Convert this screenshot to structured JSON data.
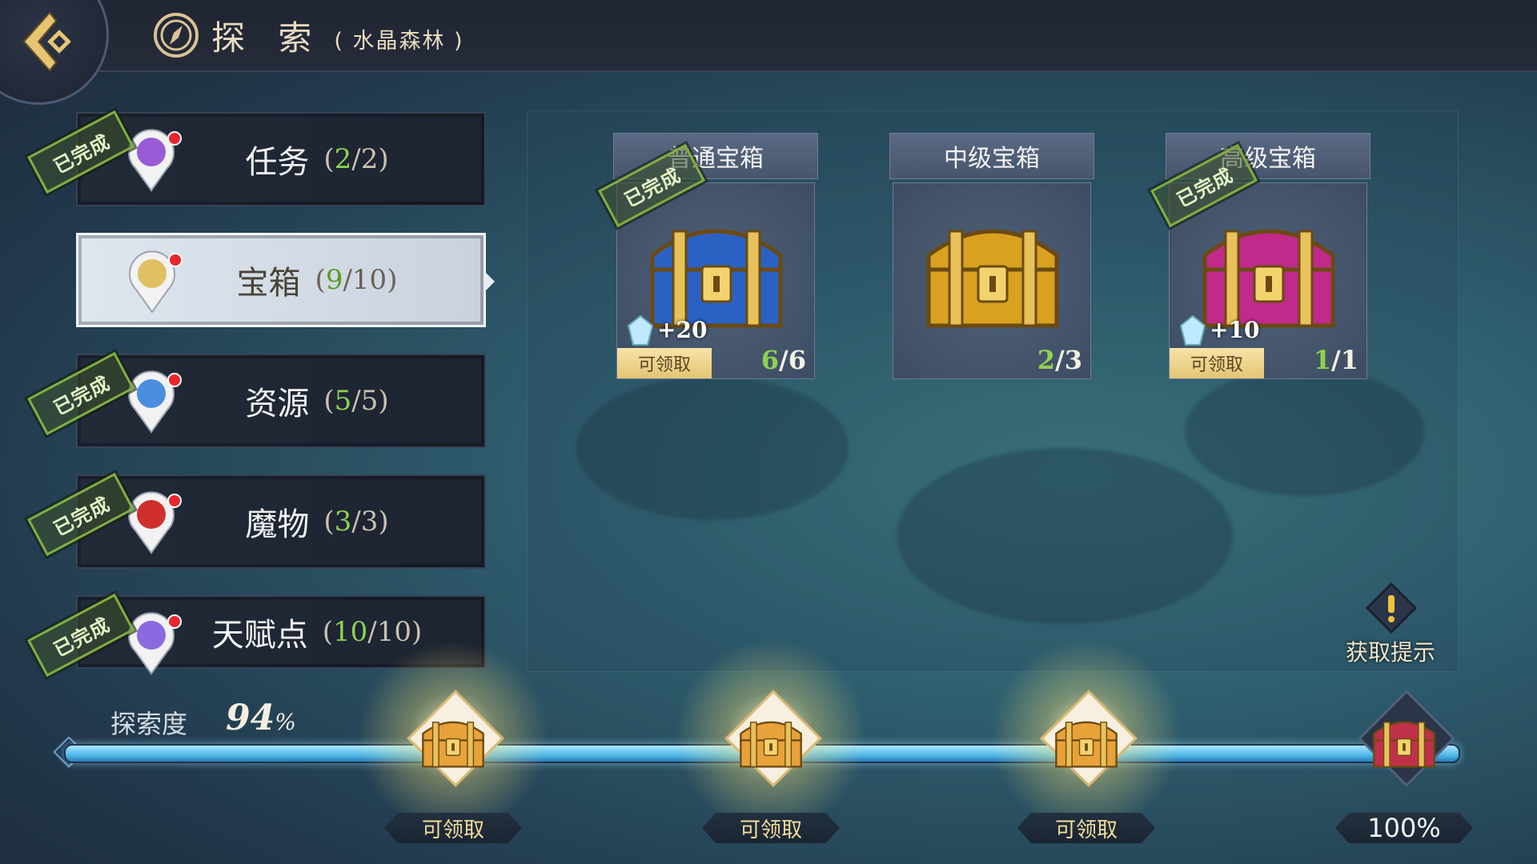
{
  "header": {
    "title": "探 索",
    "subtitle": "( 水晶森林 )"
  },
  "menu": [
    {
      "label": "任务",
      "done": "2",
      "total": "2",
      "stamp": "已完成",
      "completed": true,
      "active": false
    },
    {
      "label": "宝箱",
      "done": "9",
      "total": "10",
      "stamp": "",
      "completed": false,
      "active": true
    },
    {
      "label": "资源",
      "done": "5",
      "total": "5",
      "stamp": "已完成",
      "completed": true,
      "active": false
    },
    {
      "label": "魔物",
      "done": "3",
      "total": "3",
      "stamp": "已完成",
      "completed": true,
      "active": false
    },
    {
      "label": "天赋点",
      "done": "10",
      "total": "10",
      "stamp": "已完成",
      "completed": true,
      "active": false
    }
  ],
  "chests": [
    {
      "title": "普通宝箱",
      "done": "6",
      "total": "6",
      "bonus": "+20",
      "claim": "可领取",
      "stamp": "已完成",
      "color": "#2a62c4"
    },
    {
      "title": "中级宝箱",
      "done": "2",
      "total": "3",
      "bonus": "",
      "claim": "",
      "stamp": "",
      "color": "#d9a11f"
    },
    {
      "title": "高级宝箱",
      "done": "1",
      "total": "1",
      "bonus": "+10",
      "claim": "可领取",
      "stamp": "已完成",
      "color": "#c02a8a"
    }
  ],
  "hint": {
    "label": "获取提示",
    "icon": "exclamation-icon"
  },
  "progress": {
    "label": "探索度",
    "value": "94",
    "unit": "%",
    "milestones": [
      {
        "tag": "可领取",
        "claimable": true
      },
      {
        "tag": "可领取",
        "claimable": true
      },
      {
        "tag": "可领取",
        "claimable": true
      },
      {
        "tag": "100%",
        "claimable": false
      }
    ]
  },
  "colors": {
    "accent_green": "#8fd150",
    "gold": "#e4c574",
    "track": "#4fb7e8"
  }
}
